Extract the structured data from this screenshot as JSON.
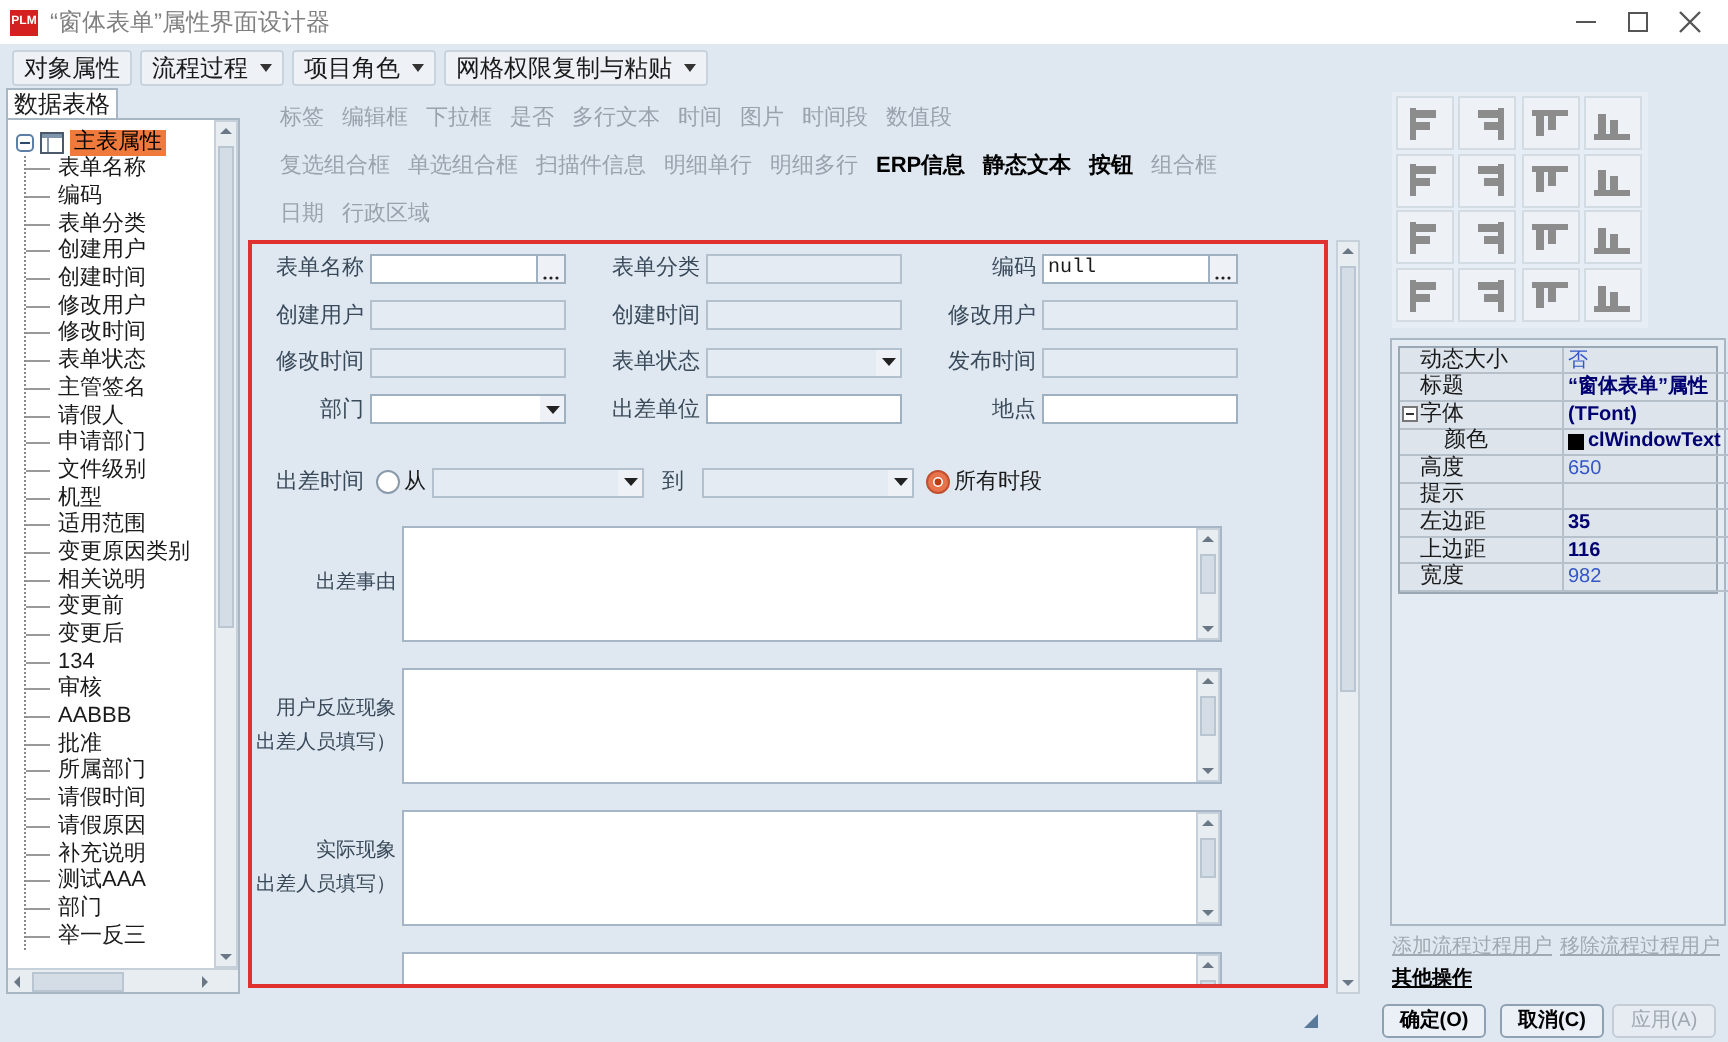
{
  "window": {
    "logo_text": "PLM",
    "title": "“窗体表单”属性界面设计器"
  },
  "toolbar": [
    {
      "label": "对象属性",
      "has_menu": false
    },
    {
      "label": "流程过程",
      "has_menu": true
    },
    {
      "label": "项目角色",
      "has_menu": true
    },
    {
      "label": "网格权限复制与粘贴",
      "has_menu": true
    }
  ],
  "left_tab": {
    "label": "数据表格",
    "selected": true
  },
  "tree": [
    {
      "label": "主表属性",
      "expanded": true,
      "selected": true,
      "children": [
        {
          "label": "表单名称",
          "selected": false
        },
        {
          "label": "编码",
          "selected": false
        },
        {
          "label": "表单分类",
          "selected": false
        },
        {
          "label": "创建用户",
          "selected": false
        },
        {
          "label": "创建时间",
          "selected": false
        },
        {
          "label": "修改用户",
          "selected": false
        },
        {
          "label": "修改时间",
          "selected": false
        },
        {
          "label": "表单状态",
          "selected": false
        },
        {
          "label": "主管签名",
          "selected": false
        },
        {
          "label": "请假人",
          "selected": false
        },
        {
          "label": "申请部门",
          "selected": false
        },
        {
          "label": "文件级别",
          "selected": false
        },
        {
          "label": "机型",
          "selected": false
        },
        {
          "label": "适用范围",
          "selected": false
        },
        {
          "label": "变更原因类别",
          "selected": false
        },
        {
          "label": "相关说明",
          "selected": false
        },
        {
          "label": "变更前",
          "selected": false
        },
        {
          "label": "变更后",
          "selected": false
        },
        {
          "label": "134",
          "selected": false
        },
        {
          "label": "审核",
          "selected": false
        },
        {
          "label": "AABBB",
          "selected": false
        },
        {
          "label": "批准",
          "selected": false
        },
        {
          "label": "所属部门",
          "selected": false
        },
        {
          "label": "请假时间",
          "selected": false
        },
        {
          "label": "请假原因",
          "selected": false
        },
        {
          "label": "补充说明",
          "selected": false
        },
        {
          "label": "测试AAA",
          "selected": false
        },
        {
          "label": "部门",
          "selected": false
        },
        {
          "label": "举一反三",
          "selected": false
        }
      ]
    }
  ],
  "palette": [
    [
      {
        "label": "标签",
        "disabled": true
      },
      {
        "label": "编辑框",
        "disabled": true
      },
      {
        "label": "下拉框",
        "disabled": true
      },
      {
        "label": "是否",
        "disabled": true
      },
      {
        "label": "多行文本",
        "disabled": true
      },
      {
        "label": "时间",
        "disabled": true
      },
      {
        "label": "图片",
        "disabled": true
      },
      {
        "label": "时间段",
        "disabled": true
      },
      {
        "label": "数值段",
        "disabled": true
      }
    ],
    [
      {
        "label": "复选组合框",
        "disabled": true
      },
      {
        "label": "单选组合框",
        "disabled": true
      },
      {
        "label": "扫描件信息",
        "disabled": true
      },
      {
        "label": "明细单行",
        "disabled": true
      },
      {
        "label": "明细多行",
        "disabled": true
      },
      {
        "label": "ERP信息",
        "disabled": false
      },
      {
        "label": "静态文本",
        "disabled": false
      },
      {
        "label": "按钮",
        "disabled": false
      },
      {
        "label": "组合框",
        "disabled": true
      }
    ],
    [
      {
        "label": "日期",
        "disabled": true
      },
      {
        "label": "行政区域",
        "disabled": true
      }
    ]
  ],
  "form": {
    "fields": [
      {
        "label": "表单名称",
        "kind": "ellipsis"
      },
      {
        "label": "表单分类",
        "kind": "readonly"
      },
      {
        "label": "编码",
        "kind": "ellipsis",
        "value": "null"
      },
      {
        "label": "创建用户",
        "kind": "readonly"
      },
      {
        "label": "创建时间",
        "kind": "readonly"
      },
      {
        "label": "修改用户",
        "kind": "readonly"
      },
      {
        "label": "修改时间",
        "kind": "readonly"
      },
      {
        "label": "表单状态",
        "kind": "combo_readonly"
      },
      {
        "label": "发布时间",
        "kind": "readonly"
      },
      {
        "label": "部门",
        "kind": "combo"
      },
      {
        "label": "出差单位",
        "kind": "text"
      },
      {
        "label": "地点",
        "kind": "text"
      }
    ],
    "trip_time": {
      "label": "出差时间",
      "from_option": {
        "label": "从",
        "selected": false
      },
      "to_label": "到",
      "all_option": {
        "label": "所有时段",
        "selected": true
      }
    },
    "memos": [
      {
        "kind": "memo",
        "label": [
          "出差事由"
        ]
      },
      {
        "kind": "memo",
        "label": [
          "用户反应现象",
          "出差人员填写）"
        ]
      },
      {
        "kind": "memo",
        "label": [
          "实际现象",
          "出差人员填写）"
        ]
      },
      {
        "kind": "memo"
      }
    ]
  },
  "properties": [
    {
      "name": "动态大小",
      "value": "否",
      "modified": false
    },
    {
      "name": "标题",
      "value": "“窗体表单”属性",
      "modified": true
    },
    {
      "name": "字体",
      "value": "(TFont)",
      "modified": true,
      "kind": "group",
      "expanded": true
    },
    {
      "name": "颜色",
      "value": "clWindowText",
      "modified": true,
      "kind": "color",
      "color": "#000000"
    },
    {
      "name": "高度",
      "value": "650",
      "modified": false
    },
    {
      "name": "提示"
    },
    {
      "name": "左边距",
      "value": "35",
      "modified": true
    },
    {
      "name": "上边距",
      "value": "116",
      "modified": true
    },
    {
      "name": "宽度",
      "value": "982",
      "modified": false
    }
  ],
  "links": [
    {
      "label": "添加流程过程用户",
      "disabled": true
    },
    {
      "label": "移除流程过程用户",
      "disabled": true
    },
    {
      "label": "其他操作",
      "disabled": false
    }
  ],
  "buttons": [
    {
      "label": "确定(O)",
      "disabled": false
    },
    {
      "label": "取消(C)",
      "disabled": false
    },
    {
      "label": "应用(A)",
      "disabled": true
    }
  ]
}
